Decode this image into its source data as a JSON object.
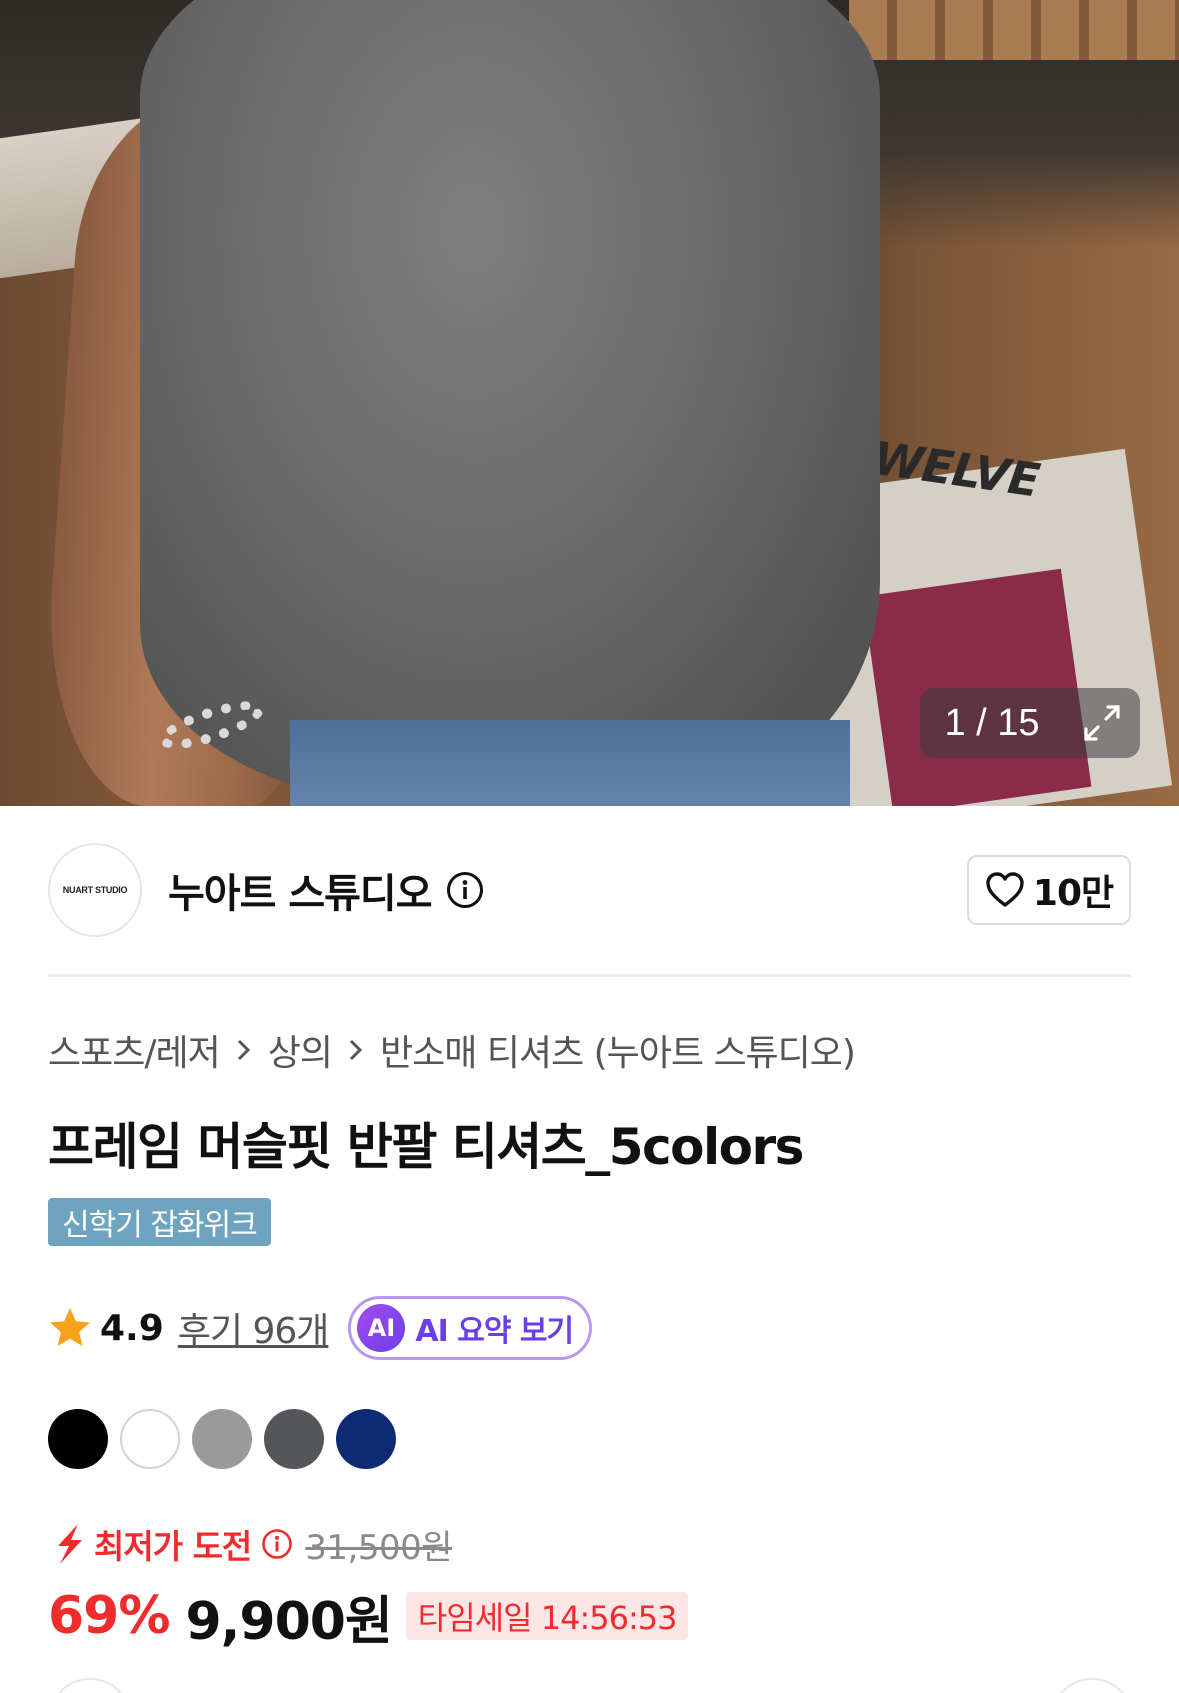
{
  "gallery": {
    "current": "1",
    "total": "15",
    "counter_text": "1 / 15",
    "photo_text": "TWELVE"
  },
  "store": {
    "logo_text": "NUART STUDIO",
    "name": "누아트 스튜디오",
    "like_count": "10만"
  },
  "breadcrumb": [
    "스포츠/레저",
    "상의",
    "반소매 티셔츠 (누아트 스튜디오)"
  ],
  "product": {
    "title": "프레임 머슬핏 반팔 티셔츠_5colors",
    "promo_tag": "신학기 잡화위크",
    "rating": "4.9",
    "reviews_label": "후기 96개",
    "ai_badge": "AI",
    "ai_label": "AI 요약 보기"
  },
  "colors": [
    "#000000",
    "#ffffff",
    "#9a9a9a",
    "#555659",
    "#0d2a73"
  ],
  "price": {
    "lowest_label": "최저가 도전",
    "original": "31,500원",
    "discount": "69%",
    "sale": "9,900원",
    "timesale": "타임세일 14:56:53"
  },
  "theme": {
    "accent_red": "#ee2c2c",
    "ai_purple": "#6a3fe8",
    "tag_blue": "#6ea4bf"
  }
}
